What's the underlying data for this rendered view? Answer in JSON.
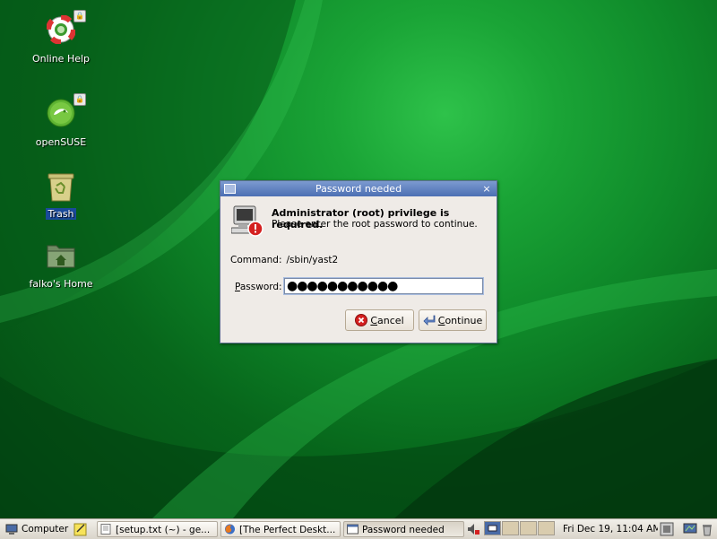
{
  "desktop": {
    "icons": [
      {
        "label": "Online Help",
        "icon": "lifebuoy-icon",
        "locked": true
      },
      {
        "label": "openSUSE",
        "icon": "opensuse-logo-icon",
        "locked": true
      },
      {
        "label": "Trash",
        "icon": "trash-icon",
        "locked": false
      },
      {
        "label": "falko's Home",
        "icon": "home-folder-icon",
        "locked": false
      }
    ]
  },
  "dialog": {
    "title": "Password needed",
    "close_symbol": "×",
    "heading": "Administrator (root) privilege is required.",
    "subtext": "Please enter the root password to continue.",
    "command_label": "Command:",
    "command_value": "/sbin/yast2",
    "password_label_mnemonic": "P",
    "password_label_rest": "assword:",
    "password_value": "●●●●●●●●●●●",
    "cancel_mnemonic": "C",
    "cancel_rest": "ancel",
    "continue_mnemonic": "C",
    "continue_rest": "ontinue"
  },
  "taskbar": {
    "computer_label": "Computer",
    "windows": [
      {
        "label": "[setup.txt (~) - ge...",
        "icon": "text-editor-icon",
        "active": false
      },
      {
        "label": "[The Perfect Deskt...",
        "icon": "firefox-icon",
        "active": false
      },
      {
        "label": "Password needed",
        "icon": "dialog-window-icon",
        "active": true
      }
    ],
    "clock": "Fri Dec 19, 11:04 AM"
  },
  "colors": {
    "desktop_green": "#0f8a2a",
    "titlebar_blue": "#4c6fb3",
    "dialog_bg": "#efebe7",
    "error_red": "#d42020"
  }
}
